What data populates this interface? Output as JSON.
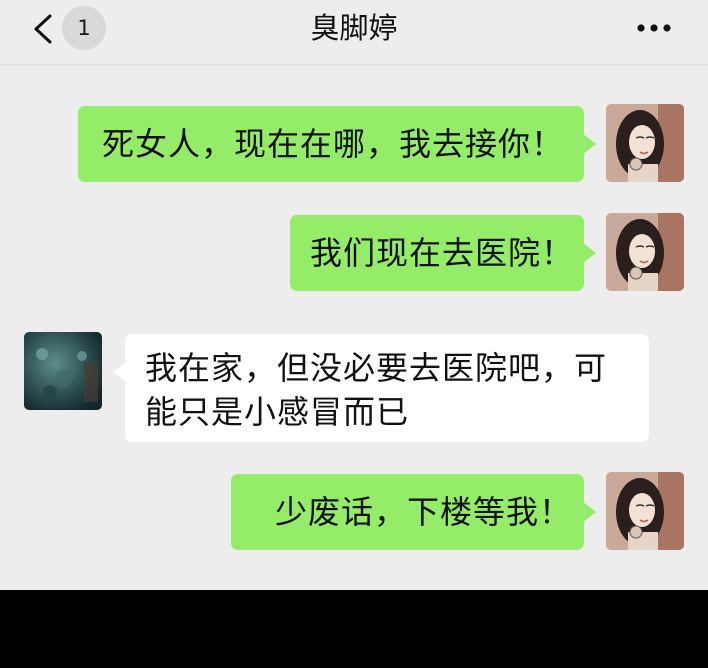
{
  "header": {
    "back_icon": "chevron-left-icon",
    "unread_count": "1",
    "title": "臭脚婷",
    "more_icon": "more-dots-icon"
  },
  "messages": [
    {
      "side": "out",
      "text": "死女人，现在在哪，我去接你！",
      "avatar": "woman-portrait-avatar"
    },
    {
      "side": "out",
      "text": "我们现在去医院！",
      "avatar": "woman-portrait-avatar"
    },
    {
      "side": "in",
      "text": "我在家，但没必要去医院吧，可能只是小感冒而已",
      "avatar": "dark-teal-avatar"
    },
    {
      "side": "out",
      "text": "少废话，下楼等我！",
      "avatar": "woman-portrait-avatar"
    }
  ],
  "colors": {
    "chat_background": "#ededed",
    "outgoing_bubble": "#95ec69",
    "incoming_bubble": "#ffffff",
    "unread_badge": "#d9d9d9"
  }
}
